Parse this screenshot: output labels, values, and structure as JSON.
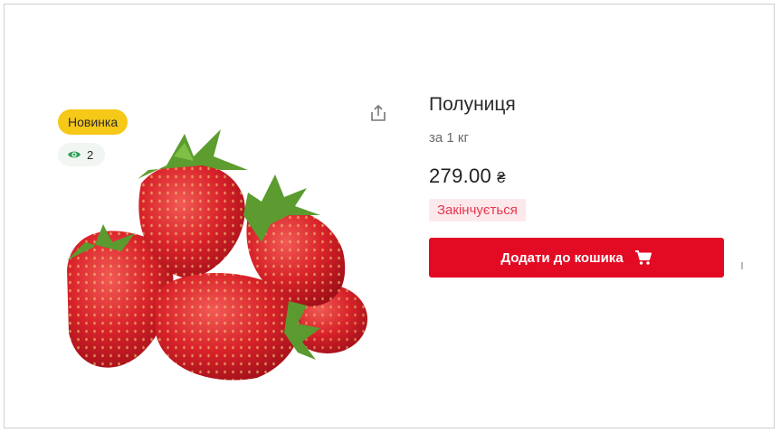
{
  "product": {
    "badge_new": "Новинка",
    "views_count": "2",
    "title": "Полуниця",
    "unit": "за 1 кг",
    "price_value": "279.00",
    "price_currency": "₴",
    "stock_status": "Закінчується",
    "add_to_cart_label": "Додати до кошика"
  },
  "icons": {
    "views": "eye-icon",
    "share": "share-icon",
    "cart": "cart-icon"
  },
  "colors": {
    "accent": "#e30b24",
    "badge_new_bg": "#f6c817",
    "stock_text": "#e8354e",
    "stock_bg": "#fde9ec",
    "views_icon": "#2e9e55"
  }
}
